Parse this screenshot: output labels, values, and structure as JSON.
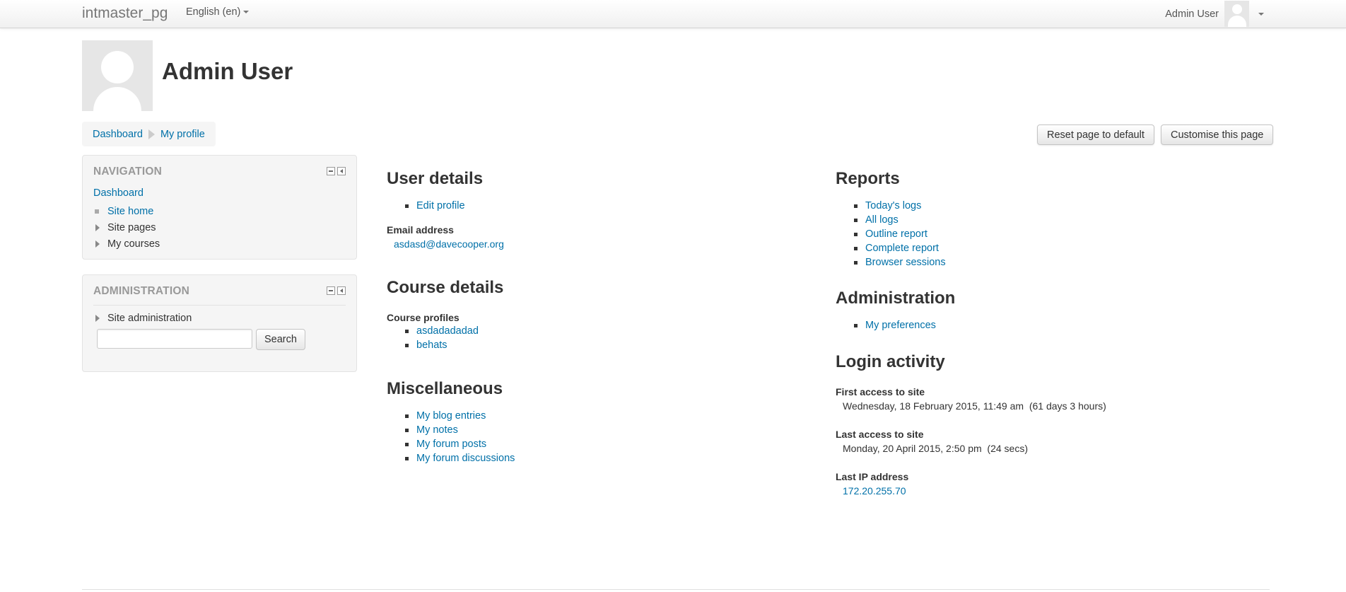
{
  "topbar": {
    "site_name": "intmaster_pg",
    "language": "English (en)",
    "user_name": "Admin User"
  },
  "header": {
    "title": "Admin User"
  },
  "breadcrumb": [
    "Dashboard",
    "My profile"
  ],
  "page_buttons": {
    "reset": "Reset page to default",
    "customise": "Customise this page"
  },
  "navigation_block": {
    "title": "NAVIGATION",
    "root": "Dashboard",
    "items": [
      {
        "label": "Site home",
        "type": "link"
      },
      {
        "label": "Site pages",
        "type": "branch"
      },
      {
        "label": "My courses",
        "type": "branch"
      }
    ]
  },
  "administration_block": {
    "title": "ADMINISTRATION",
    "item": "Site administration",
    "search_button": "Search",
    "search_value": ""
  },
  "user_details": {
    "title": "User details",
    "edit_profile": "Edit profile",
    "email_label": "Email address",
    "email": "asdasd@davecooper.org"
  },
  "course_details": {
    "title": "Course details",
    "profiles_label": "Course profiles",
    "courses": [
      "asdadadadad",
      "behats"
    ]
  },
  "miscellaneous": {
    "title": "Miscellaneous",
    "links": [
      "My blog entries",
      "My notes",
      "My forum posts",
      "My forum discussions"
    ]
  },
  "reports": {
    "title": "Reports",
    "links": [
      "Today's logs",
      "All logs",
      "Outline report",
      "Complete report",
      "Browser sessions"
    ]
  },
  "administration": {
    "title": "Administration",
    "links": [
      "My preferences"
    ]
  },
  "login_activity": {
    "title": "Login activity",
    "first_access_label": "First access to site",
    "first_access": "Wednesday, 18 February 2015, 11:49 am  (61 days 3 hours)",
    "last_access_label": "Last access to site",
    "last_access": "Monday, 20 April 2015, 2:50 pm  (24 secs)",
    "last_ip_label": "Last IP address",
    "last_ip": "172.20.255.70"
  },
  "colors": {
    "link": "#0070a8",
    "block_bg": "#f5f5f5",
    "block_title": "#999999"
  }
}
